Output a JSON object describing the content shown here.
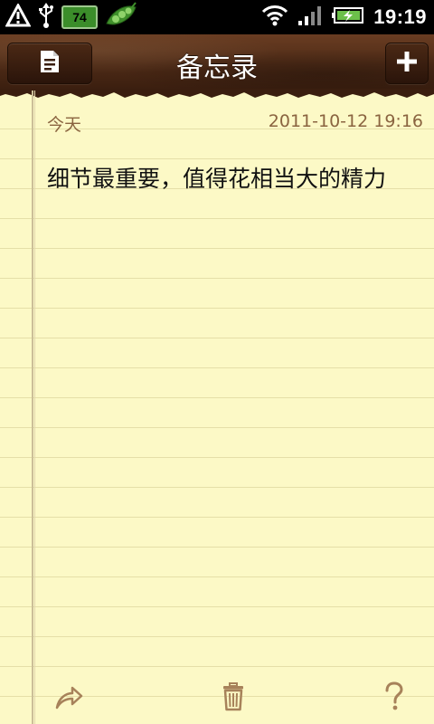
{
  "status_bar": {
    "battery_percent_badge": "74",
    "time": "19:19",
    "icons": [
      "warning-icon",
      "usb-icon",
      "battery-badge",
      "peas-icon",
      "wifi-icon",
      "signal-icon",
      "battery-icon"
    ]
  },
  "header": {
    "title": "备忘录",
    "left_button_icon": "notes-list-icon",
    "right_button_icon": "plus-icon"
  },
  "note": {
    "day_label": "今天",
    "timestamp": "2011-10-12 19:16",
    "body": "细节最重要，值得花相当大的精力"
  },
  "bottom_bar": {
    "icons": [
      "share-arrow-icon",
      "trash-icon",
      "help-icon"
    ]
  },
  "colors": {
    "paper": "#fcf9c6",
    "rule_line": "#e5dfa8",
    "meta_text": "#8a6440",
    "leather": "#4d2a16"
  }
}
